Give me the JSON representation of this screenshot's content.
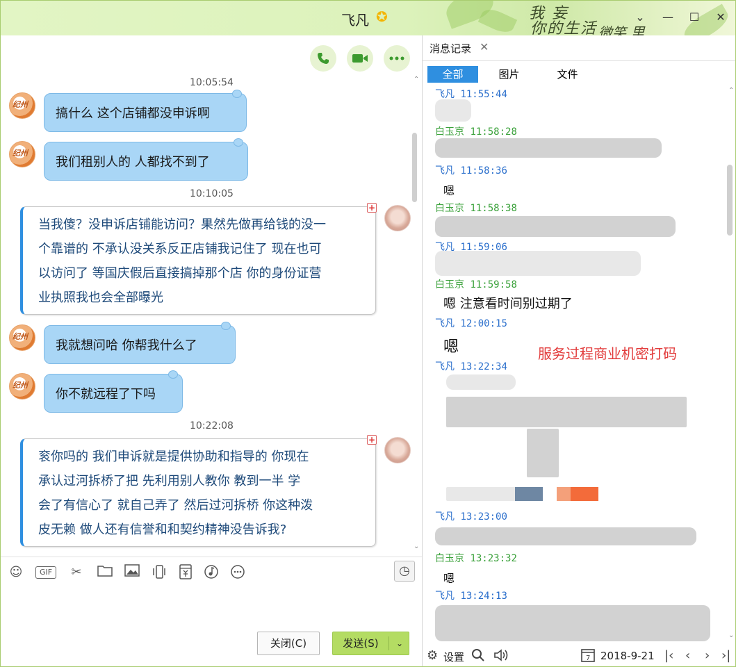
{
  "window": {
    "title": "飞凡",
    "title_badge": "star"
  },
  "decor": {
    "line1": "我 妄",
    "line2": "你的生活",
    "line3": "微笑 里"
  },
  "header_actions": [
    "phone-icon",
    "video-icon",
    "more-icon"
  ],
  "chat": {
    "timestamps": [
      "10:05:54",
      "10:10:05",
      "10:22:08"
    ],
    "messages": [
      {
        "side": "left",
        "text": "搞什么  这个店铺都没申诉啊"
      },
      {
        "side": "left",
        "text": "我们租别人的  人都找不到了"
      },
      {
        "side": "right",
        "lines": [
          "当我傻？没申诉店铺能访问？果然先做再给钱的没一",
          "个靠谱的      不承认没关系反正店铺我记住了 现在也可",
          "以访问了  等国庆假后直接搞掉那个店  你的身份证营",
          "业执照我也会全部曝光"
        ]
      },
      {
        "side": "left",
        "text": "我就想问哈 你帮我什么了"
      },
      {
        "side": "left",
        "text": "你不就远程了下吗"
      },
      {
        "side": "right",
        "lines": [
          "衮你吗的  我们申诉就是提供协助和指导的      你现在",
          "承认过河拆桥了把      先利用别人教你  教到一半  学",
          "会了有信心了 就自己弄了  然后过河拆桥    你这种泼",
          "皮无赖 做人还有信誉和和契约精神没告诉我?"
        ]
      }
    ]
  },
  "toolbar": {
    "icons": [
      "emoji-icon",
      "gif-icon",
      "scissors-icon",
      "folder-icon",
      "image-icon",
      "shake-icon",
      "red-packet-icon",
      "music-icon",
      "more-circle-icon"
    ],
    "gif_label": "GIF",
    "history_icon": "clock-icon"
  },
  "buttons": {
    "close": "关闭(C)",
    "send": "发送(S)"
  },
  "history": {
    "tab_label": "消息记录",
    "filters": [
      "全部",
      "图片",
      "文件"
    ],
    "entries": [
      {
        "sender": "飞凡",
        "time": "11:55:44",
        "color": "blue",
        "text": ""
      },
      {
        "sender": "白玉京",
        "time": "11:58:28",
        "color": "green",
        "text": ""
      },
      {
        "sender": "飞凡",
        "time": "11:58:36",
        "color": "blue",
        "text": "嗯"
      },
      {
        "sender": "白玉京",
        "time": "11:58:38",
        "color": "green",
        "text": ""
      },
      {
        "sender": "飞凡",
        "time": "11:59:06",
        "color": "blue",
        "text": ""
      },
      {
        "sender": "白玉京",
        "time": "11:59:58",
        "color": "green",
        "text": "嗯 注意看时间别过期了"
      },
      {
        "sender": "飞凡",
        "time": "12:00:15",
        "color": "blue",
        "text": "嗯"
      },
      {
        "sender": "飞凡",
        "time": "13:22:34",
        "color": "blue",
        "text": ""
      },
      {
        "sender": "飞凡",
        "time": "13:23:00",
        "color": "blue",
        "text": ""
      },
      {
        "sender": "白玉京",
        "time": "13:23:32",
        "color": "green",
        "text": "嗯"
      },
      {
        "sender": "飞凡",
        "time": "13:24:13",
        "color": "blue",
        "text": ""
      }
    ],
    "notice": "服务过程商业机密打码",
    "bottom": {
      "settings": "设置",
      "date": "2018-9-21"
    }
  },
  "colors": {
    "accent_green": "#b4dc63",
    "accent_blue": "#2f8fe0",
    "bubble_blue": "#a9d6f6",
    "notice_red": "#e23c3c"
  }
}
